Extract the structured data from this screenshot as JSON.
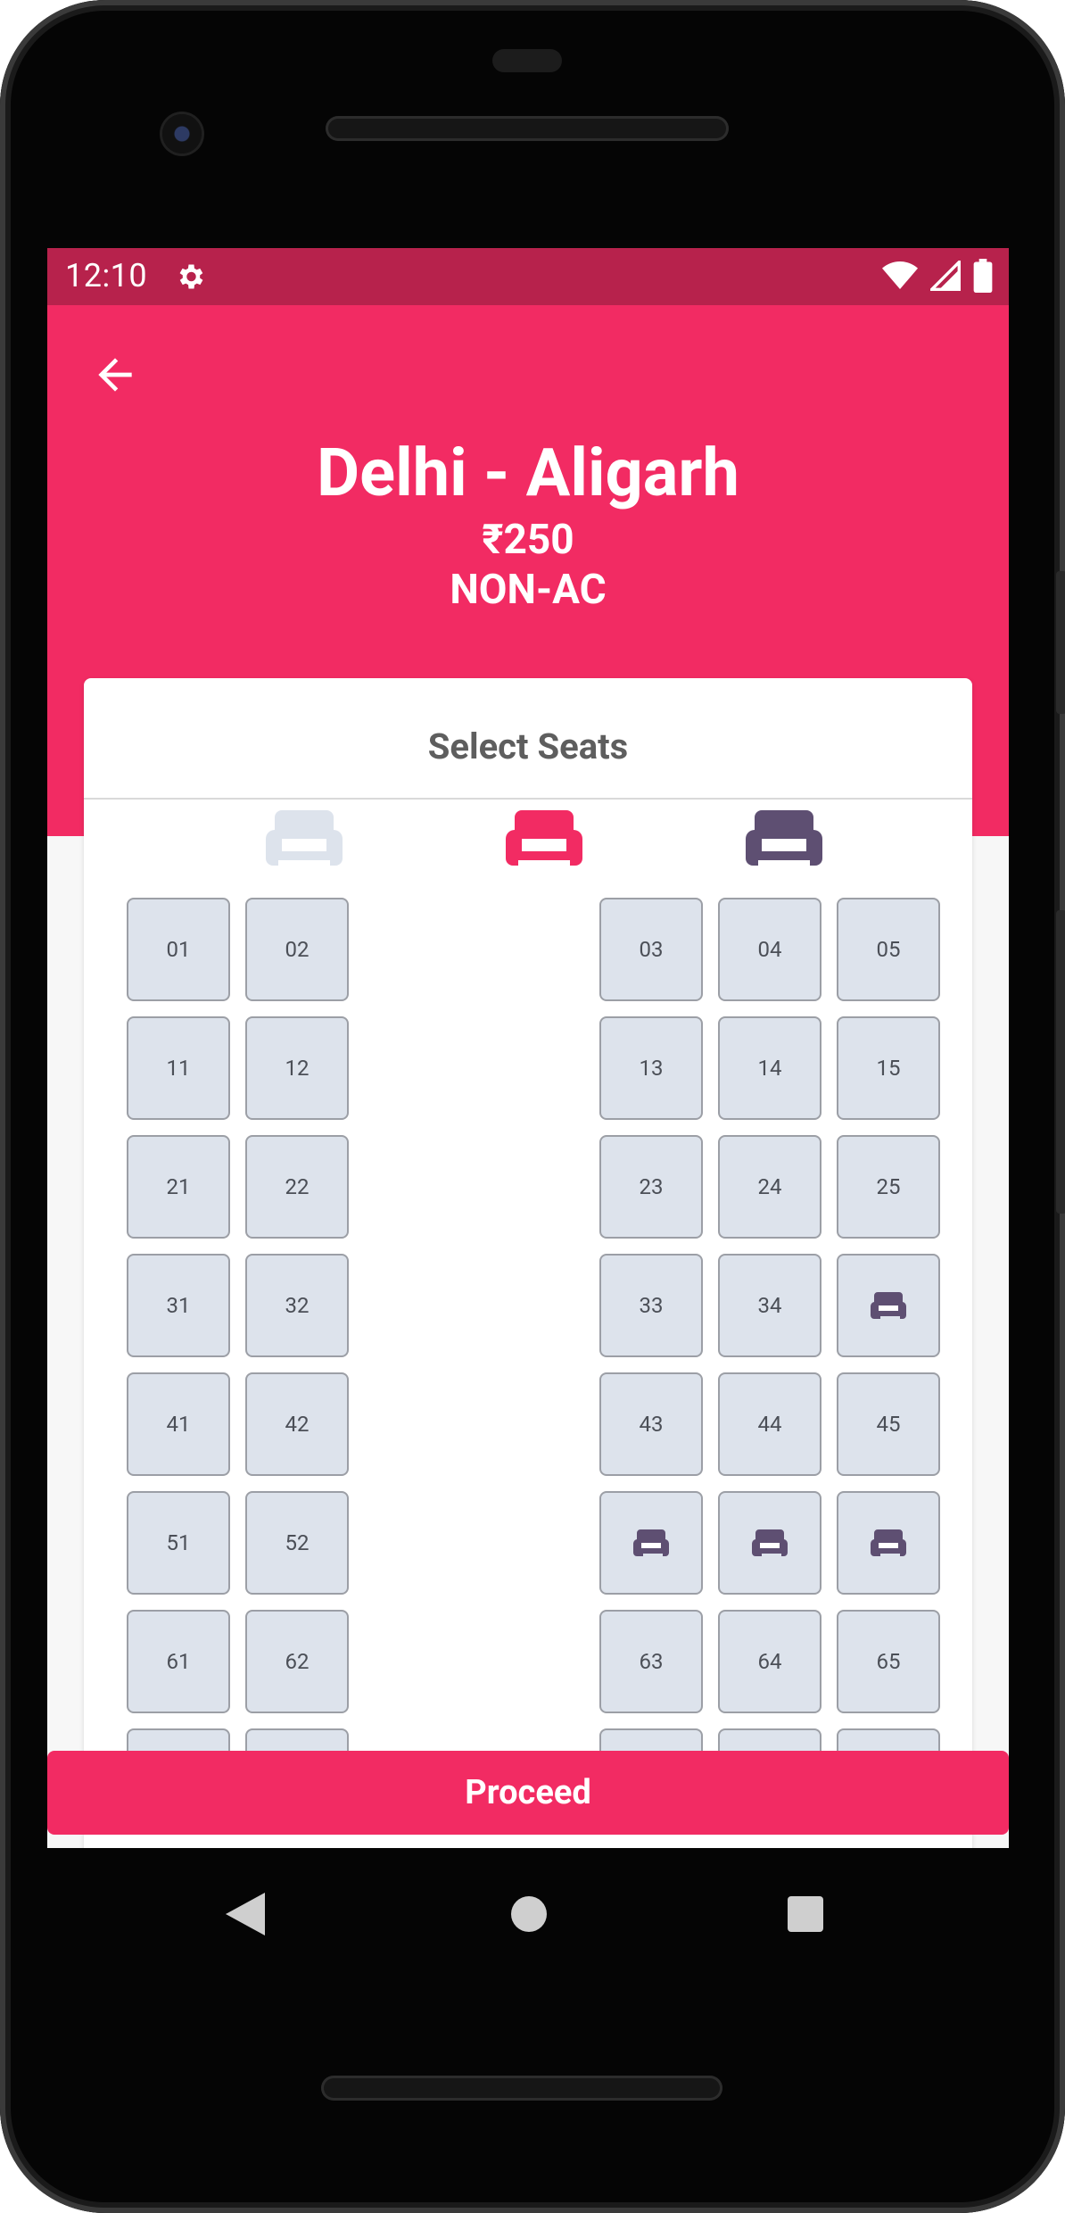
{
  "status": {
    "time": "12:10"
  },
  "header": {
    "route": "Delhi - Aligarh",
    "price": "₹250",
    "coach_type": "NON-AC"
  },
  "card": {
    "title": "Select Seats"
  },
  "legend": [
    {
      "name": "available",
      "color": "#dde3ec"
    },
    {
      "name": "selected",
      "color": "#f22b63"
    },
    {
      "name": "booked",
      "color": "#5e4f72"
    }
  ],
  "seats": {
    "rows": [
      {
        "left": [
          "01",
          "02"
        ],
        "right": [
          "03",
          "04",
          "05"
        ]
      },
      {
        "left": [
          "11",
          "12"
        ],
        "right": [
          "13",
          "14",
          "15"
        ]
      },
      {
        "left": [
          "21",
          "22"
        ],
        "right": [
          "23",
          "24",
          "25"
        ]
      },
      {
        "left": [
          "31",
          "32"
        ],
        "right": [
          "33",
          "34",
          "booked"
        ]
      },
      {
        "left": [
          "41",
          "42"
        ],
        "right": [
          "43",
          "44",
          "45"
        ]
      },
      {
        "left": [
          "51",
          "52"
        ],
        "right": [
          "booked",
          "booked",
          "booked"
        ]
      },
      {
        "left": [
          "61",
          "62"
        ],
        "right": [
          "63",
          "64",
          "65"
        ]
      },
      {
        "left": [
          "",
          ""
        ],
        "right": [
          "",
          "",
          ""
        ]
      }
    ]
  },
  "actions": {
    "proceed_label": "Proceed"
  },
  "colors": {
    "accent": "#f22b63",
    "status_bar": "#b7224c",
    "booked": "#5e4f72"
  }
}
